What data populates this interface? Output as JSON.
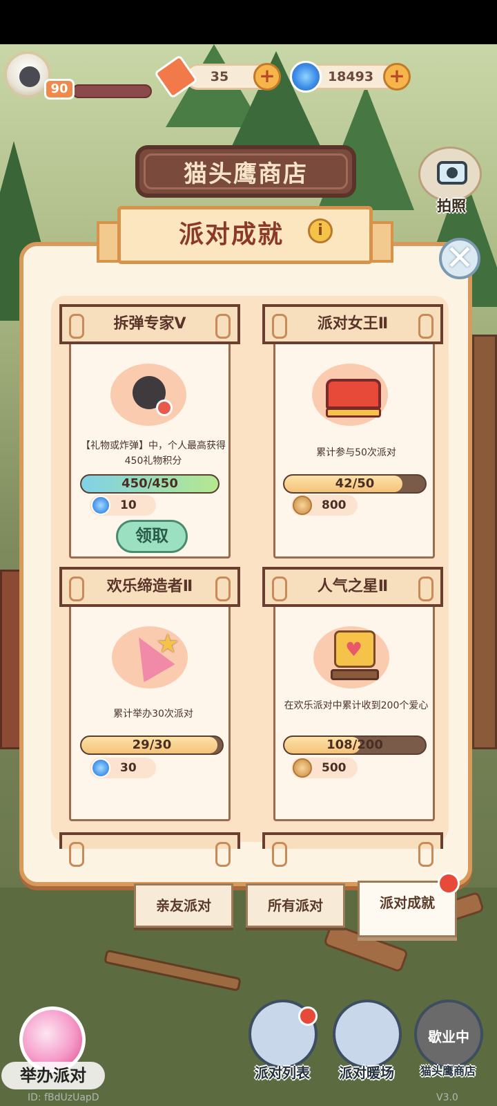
{
  "hud": {
    "level": "90",
    "tickets": "35",
    "swirls": "18493",
    "camera_label": "拍照"
  },
  "shop_sign": "猫头鹰商店",
  "panel": {
    "title": "派对成就",
    "info_glyph": "i",
    "close_glyph": "✕"
  },
  "achievements": [
    {
      "title": "拆弹专家Ⅴ",
      "desc": "【礼物或炸弹】中，个人最高获得450礼物积分",
      "progress_text": "450/450",
      "progress": 1.0,
      "reward_type": "swirl",
      "reward": "10",
      "claim_label": "领取"
    },
    {
      "title": "派对女王Ⅱ",
      "desc": "累计参与50次派对",
      "progress_text": "42/50",
      "progress": 0.84,
      "reward_type": "coin",
      "reward": "800"
    },
    {
      "title": "欢乐缔造者Ⅱ",
      "desc": "累计举办30次派对",
      "progress_text": "29/30",
      "progress": 0.967,
      "reward_type": "swirl",
      "reward": "30"
    },
    {
      "title": "人气之星Ⅱ",
      "desc": "在欢乐派对中累计收到200个爱心",
      "progress_text": "108/200",
      "progress": 0.54,
      "reward_type": "coin",
      "reward": "500"
    }
  ],
  "tabs": [
    {
      "label": "亲友派对",
      "active": false
    },
    {
      "label": "所有派对",
      "active": false
    },
    {
      "label": "派对成就",
      "active": true
    }
  ],
  "bottom_nav": {
    "host_party": "举办派对",
    "party_list": "派对列表",
    "party_warmup": "派对暖场",
    "owl_shop": "猫头鹰商店",
    "shop_status": "歇业中"
  },
  "footer": {
    "id": "ID: fBdUzUapD",
    "version": "V3.0"
  },
  "colors": {
    "panel_border": "#d79a5a",
    "accent_red": "#8a3a2a",
    "claim_green": "#9be0c0"
  }
}
